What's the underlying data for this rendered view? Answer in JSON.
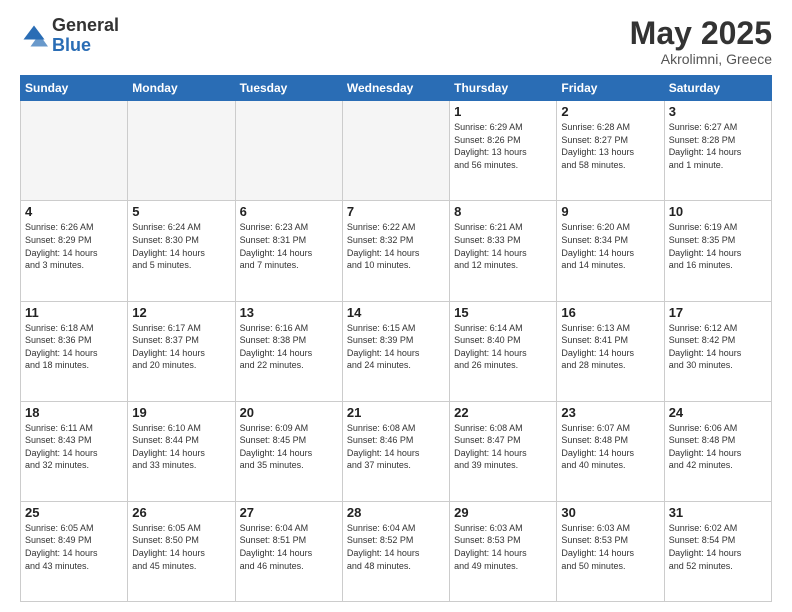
{
  "logo": {
    "general": "General",
    "blue": "Blue"
  },
  "title": "May 2025",
  "subtitle": "Akrolimni, Greece",
  "days": [
    "Sunday",
    "Monday",
    "Tuesday",
    "Wednesday",
    "Thursday",
    "Friday",
    "Saturday"
  ],
  "weeks": [
    [
      {
        "day": "",
        "content": ""
      },
      {
        "day": "",
        "content": ""
      },
      {
        "day": "",
        "content": ""
      },
      {
        "day": "",
        "content": ""
      },
      {
        "day": "1",
        "content": "Sunrise: 6:29 AM\nSunset: 8:26 PM\nDaylight: 13 hours\nand 56 minutes."
      },
      {
        "day": "2",
        "content": "Sunrise: 6:28 AM\nSunset: 8:27 PM\nDaylight: 13 hours\nand 58 minutes."
      },
      {
        "day": "3",
        "content": "Sunrise: 6:27 AM\nSunset: 8:28 PM\nDaylight: 14 hours\nand 1 minute."
      }
    ],
    [
      {
        "day": "4",
        "content": "Sunrise: 6:26 AM\nSunset: 8:29 PM\nDaylight: 14 hours\nand 3 minutes."
      },
      {
        "day": "5",
        "content": "Sunrise: 6:24 AM\nSunset: 8:30 PM\nDaylight: 14 hours\nand 5 minutes."
      },
      {
        "day": "6",
        "content": "Sunrise: 6:23 AM\nSunset: 8:31 PM\nDaylight: 14 hours\nand 7 minutes."
      },
      {
        "day": "7",
        "content": "Sunrise: 6:22 AM\nSunset: 8:32 PM\nDaylight: 14 hours\nand 10 minutes."
      },
      {
        "day": "8",
        "content": "Sunrise: 6:21 AM\nSunset: 8:33 PM\nDaylight: 14 hours\nand 12 minutes."
      },
      {
        "day": "9",
        "content": "Sunrise: 6:20 AM\nSunset: 8:34 PM\nDaylight: 14 hours\nand 14 minutes."
      },
      {
        "day": "10",
        "content": "Sunrise: 6:19 AM\nSunset: 8:35 PM\nDaylight: 14 hours\nand 16 minutes."
      }
    ],
    [
      {
        "day": "11",
        "content": "Sunrise: 6:18 AM\nSunset: 8:36 PM\nDaylight: 14 hours\nand 18 minutes."
      },
      {
        "day": "12",
        "content": "Sunrise: 6:17 AM\nSunset: 8:37 PM\nDaylight: 14 hours\nand 20 minutes."
      },
      {
        "day": "13",
        "content": "Sunrise: 6:16 AM\nSunset: 8:38 PM\nDaylight: 14 hours\nand 22 minutes."
      },
      {
        "day": "14",
        "content": "Sunrise: 6:15 AM\nSunset: 8:39 PM\nDaylight: 14 hours\nand 24 minutes."
      },
      {
        "day": "15",
        "content": "Sunrise: 6:14 AM\nSunset: 8:40 PM\nDaylight: 14 hours\nand 26 minutes."
      },
      {
        "day": "16",
        "content": "Sunrise: 6:13 AM\nSunset: 8:41 PM\nDaylight: 14 hours\nand 28 minutes."
      },
      {
        "day": "17",
        "content": "Sunrise: 6:12 AM\nSunset: 8:42 PM\nDaylight: 14 hours\nand 30 minutes."
      }
    ],
    [
      {
        "day": "18",
        "content": "Sunrise: 6:11 AM\nSunset: 8:43 PM\nDaylight: 14 hours\nand 32 minutes."
      },
      {
        "day": "19",
        "content": "Sunrise: 6:10 AM\nSunset: 8:44 PM\nDaylight: 14 hours\nand 33 minutes."
      },
      {
        "day": "20",
        "content": "Sunrise: 6:09 AM\nSunset: 8:45 PM\nDaylight: 14 hours\nand 35 minutes."
      },
      {
        "day": "21",
        "content": "Sunrise: 6:08 AM\nSunset: 8:46 PM\nDaylight: 14 hours\nand 37 minutes."
      },
      {
        "day": "22",
        "content": "Sunrise: 6:08 AM\nSunset: 8:47 PM\nDaylight: 14 hours\nand 39 minutes."
      },
      {
        "day": "23",
        "content": "Sunrise: 6:07 AM\nSunset: 8:48 PM\nDaylight: 14 hours\nand 40 minutes."
      },
      {
        "day": "24",
        "content": "Sunrise: 6:06 AM\nSunset: 8:48 PM\nDaylight: 14 hours\nand 42 minutes."
      }
    ],
    [
      {
        "day": "25",
        "content": "Sunrise: 6:05 AM\nSunset: 8:49 PM\nDaylight: 14 hours\nand 43 minutes."
      },
      {
        "day": "26",
        "content": "Sunrise: 6:05 AM\nSunset: 8:50 PM\nDaylight: 14 hours\nand 45 minutes."
      },
      {
        "day": "27",
        "content": "Sunrise: 6:04 AM\nSunset: 8:51 PM\nDaylight: 14 hours\nand 46 minutes."
      },
      {
        "day": "28",
        "content": "Sunrise: 6:04 AM\nSunset: 8:52 PM\nDaylight: 14 hours\nand 48 minutes."
      },
      {
        "day": "29",
        "content": "Sunrise: 6:03 AM\nSunset: 8:53 PM\nDaylight: 14 hours\nand 49 minutes."
      },
      {
        "day": "30",
        "content": "Sunrise: 6:03 AM\nSunset: 8:53 PM\nDaylight: 14 hours\nand 50 minutes."
      },
      {
        "day": "31",
        "content": "Sunrise: 6:02 AM\nSunset: 8:54 PM\nDaylight: 14 hours\nand 52 minutes."
      }
    ]
  ]
}
